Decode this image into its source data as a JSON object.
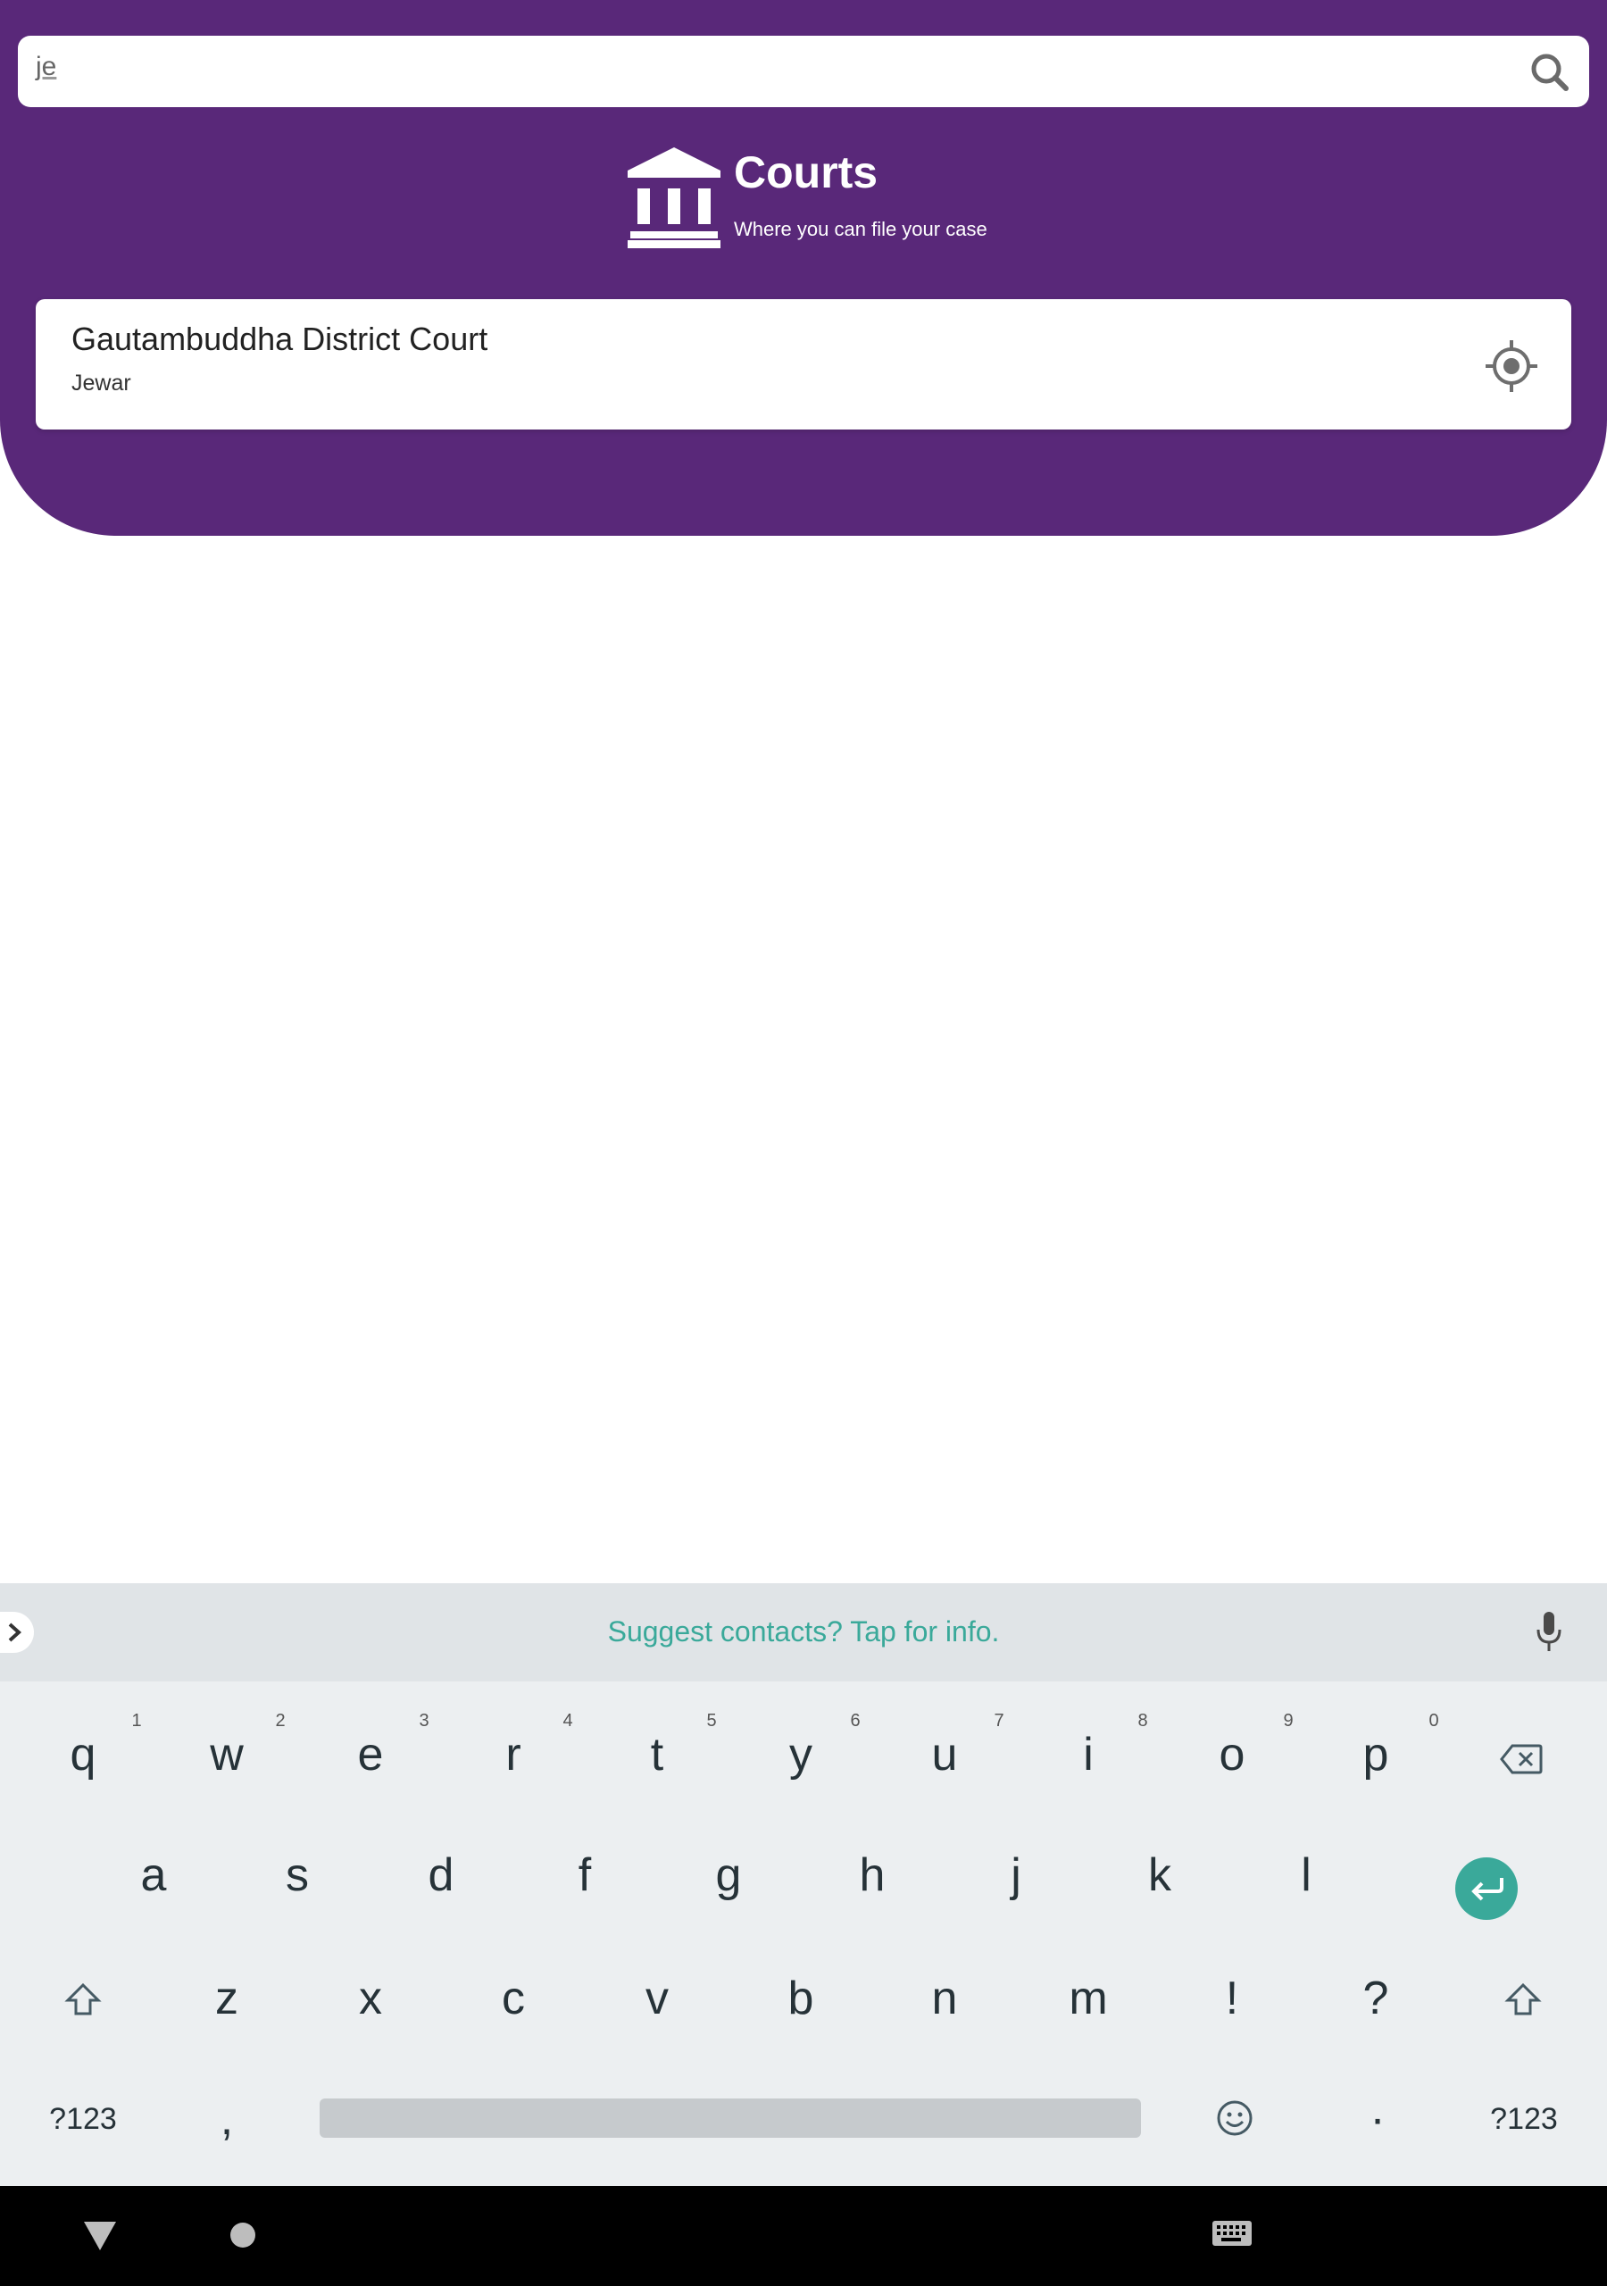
{
  "search": {
    "value": "je"
  },
  "brand": {
    "title": "Courts",
    "subtitle": "Where you can file your case"
  },
  "courts": [
    {
      "name": "Gautambuddha District Court",
      "location": "Jewar"
    }
  ],
  "keyboard": {
    "suggestion": "Suggest contacts? Tap for info.",
    "row1": [
      "q",
      "w",
      "e",
      "r",
      "t",
      "y",
      "u",
      "i",
      "o",
      "p"
    ],
    "row1_hints": [
      "1",
      "2",
      "3",
      "4",
      "5",
      "6",
      "7",
      "8",
      "9",
      "0"
    ],
    "row2": [
      "a",
      "s",
      "d",
      "f",
      "g",
      "h",
      "j",
      "k",
      "l"
    ],
    "row3": [
      "z",
      "x",
      "c",
      "v",
      "b",
      "n",
      "m",
      "!",
      "?"
    ],
    "row4": {
      "symbols_left": "?123",
      "comma": ",",
      "period": "·",
      "symbols_right": "?123"
    }
  },
  "colors": {
    "primary": "#592879",
    "accent": "#3aa99a"
  }
}
